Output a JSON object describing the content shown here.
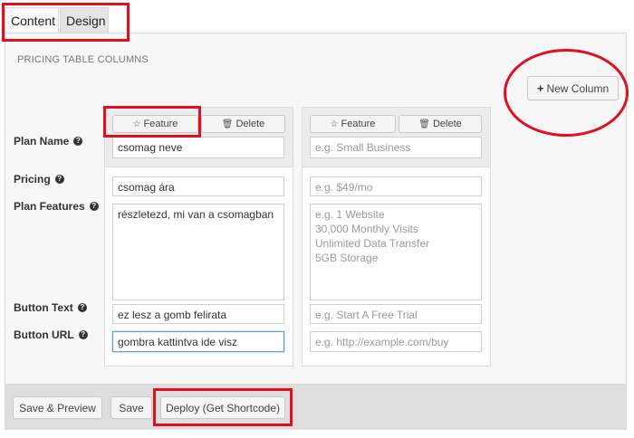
{
  "tabs": [
    {
      "label": "Content"
    },
    {
      "label": "Design"
    }
  ],
  "section_title": "PRICING TABLE COLUMNS",
  "new_column_button": {
    "icon": "plus-icon",
    "label": "New Column"
  },
  "column_buttons": {
    "feature_label": "Feature",
    "delete_label": "Delete",
    "feature_icon": "star-icon",
    "delete_icon": "trash-icon"
  },
  "row_labels": {
    "plan_name": "Plan Name",
    "pricing": "Pricing",
    "plan_features": "Plan Features",
    "button_text": "Button Text",
    "button_url": "Button URL"
  },
  "columns": [
    {
      "plan_name": "csomag neve",
      "pricing": "csomag ára",
      "plan_features": "részletezd, mi van a csomagban",
      "button_text": "ez lesz a gomb felirata",
      "button_url": "gombra kattintva ide visz"
    },
    {
      "plan_name_placeholder": "e.g. Small Business",
      "pricing_placeholder": "e.g. $49/mo",
      "plan_features_placeholder": "e.g. 1 Website\n30,000 Monthly Visits\nUnlimited Data Transfer\n5GB Storage",
      "button_text_placeholder": "e.g. Start A Free Trial",
      "button_url_placeholder": "e.g. http://example.com/buy"
    }
  ],
  "footer": {
    "save_preview_label": "Save & Preview",
    "save_label": "Save",
    "deploy_label": "Deploy (Get Shortcode)"
  },
  "colors": {
    "annotation_red": "#e01020",
    "focus_blue": "#5b9dd9"
  }
}
